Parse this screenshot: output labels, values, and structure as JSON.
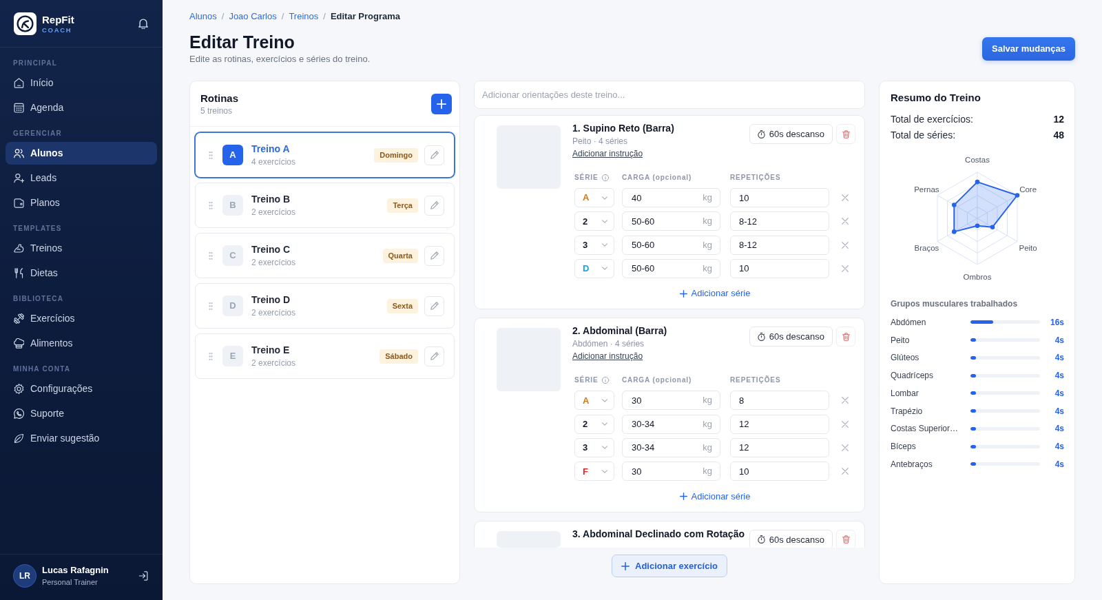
{
  "sidebar": {
    "brand": {
      "name": "RepFit",
      "tagline": "COACH"
    },
    "sections": [
      {
        "title": "PRINCIPAL",
        "items": [
          {
            "label": "Início",
            "selected": false
          },
          {
            "label": "Agenda",
            "selected": false
          }
        ]
      },
      {
        "title": "GERENCIAR",
        "items": [
          {
            "label": "Alunos",
            "selected": true
          },
          {
            "label": "Leads",
            "selected": false
          },
          {
            "label": "Planos",
            "selected": false
          }
        ]
      },
      {
        "title": "TEMPLATES",
        "items": [
          {
            "label": "Treinos",
            "selected": false
          },
          {
            "label": "Dietas",
            "selected": false
          }
        ]
      },
      {
        "title": "BIBLIOTECA",
        "items": [
          {
            "label": "Exercícios",
            "selected": false
          },
          {
            "label": "Alimentos",
            "selected": false
          }
        ]
      },
      {
        "title": "MINHA CONTA",
        "items": [
          {
            "label": "Configurações",
            "selected": false
          },
          {
            "label": "Suporte",
            "selected": false
          },
          {
            "label": "Enviar sugestão",
            "selected": false
          }
        ]
      }
    ],
    "user": {
      "initials": "LR",
      "name": "Lucas Rafagnin",
      "role": "Personal Trainer"
    }
  },
  "breadcrumb": [
    {
      "kind": "link",
      "label": "Alunos"
    },
    {
      "kind": "separator",
      "label": "/"
    },
    {
      "kind": "link",
      "label": "Joao Carlos"
    },
    {
      "kind": "separator",
      "label": "/"
    },
    {
      "kind": "link",
      "label": "Treinos"
    },
    {
      "kind": "separator",
      "label": "/"
    },
    {
      "kind": "current",
      "label": "Editar Programa"
    }
  ],
  "header": {
    "title": "Editar Treino",
    "subtitle": "Edite as rotinas, exercícios e séries do treino.",
    "save_button": "Salvar mudanças"
  },
  "routines": {
    "title": "Rotinas",
    "count": "5 treinos",
    "items": [
      {
        "letter": "A",
        "name": "Treino A",
        "exercises": "4 exercícios",
        "day": "Domingo",
        "selected": true
      },
      {
        "letter": "B",
        "name": "Treino B",
        "exercises": "2 exercícios",
        "day": "Terça",
        "selected": false
      },
      {
        "letter": "C",
        "name": "Treino C",
        "exercises": "2 exercícios",
        "day": "Quarta",
        "selected": false
      },
      {
        "letter": "D",
        "name": "Treino D",
        "exercises": "2 exercícios",
        "day": "Sexta",
        "selected": false
      },
      {
        "letter": "E",
        "name": "Treino E",
        "exercises": "2 exercícios",
        "day": "Sábado",
        "selected": false
      }
    ]
  },
  "workout": {
    "notes": {
      "placeholder": "Adicionar orientações deste treino..."
    },
    "exercises": [
      {
        "title": "1. Supino Reto (Barra)",
        "subtitle": "Peito · 4 séries",
        "instruction_link": "Adicionar instrução",
        "rest": "60s descanso",
        "columns": [
          "SÉRIE",
          "CARGA (opcional)",
          "REPETIÇÕES"
        ],
        "sets": [
          {
            "type": "A",
            "kind": "warmup",
            "load": "40",
            "unit": "kg",
            "reps": "10"
          },
          {
            "type": "2",
            "kind": "normal",
            "load": "50-60",
            "unit": "kg",
            "reps": "8-12"
          },
          {
            "type": "3",
            "kind": "normal",
            "load": "50-60",
            "unit": "kg",
            "reps": "8-12"
          },
          {
            "type": "D",
            "kind": "drop",
            "load": "50-60",
            "unit": "kg",
            "reps": "10"
          }
        ],
        "add_set": "Adicionar série"
      },
      {
        "title": "2. Abdominal (Barra)",
        "subtitle": "Abdómen · 4 séries",
        "instruction_link": "Adicionar instrução",
        "rest": "60s descanso",
        "columns": [
          "SÉRIE",
          "CARGA (opcional)",
          "REPETIÇÕES"
        ],
        "sets": [
          {
            "type": "A",
            "kind": "warmup",
            "load": "30",
            "unit": "kg",
            "reps": "8"
          },
          {
            "type": "2",
            "kind": "normal",
            "load": "30-34",
            "unit": "kg",
            "reps": "12"
          },
          {
            "type": "3",
            "kind": "normal",
            "load": "30-34",
            "unit": "kg",
            "reps": "12"
          },
          {
            "type": "F",
            "kind": "failure",
            "load": "30",
            "unit": "kg",
            "reps": "10"
          }
        ],
        "add_set": "Adicionar série"
      },
      {
        "title": "3. Abdominal Declinado com Rotação",
        "rest": "60s descanso"
      }
    ],
    "add_exercise": "Adicionar exercício"
  },
  "summary": {
    "title": "Resumo do Treino",
    "stats": [
      {
        "label": "Total de exercícios:",
        "value": "12"
      },
      {
        "label": "Total de séries:",
        "value": "48"
      }
    ],
    "radar": {
      "axes": [
        "Costas",
        "Core",
        "Peito",
        "Ombros",
        "Braços",
        "Pernas"
      ]
    },
    "muscles_title": "Grupos musculares trabalhados",
    "muscles": [
      {
        "name": "Abdómen",
        "level": 0.33,
        "value": "16s"
      },
      {
        "name": "Peito",
        "level": 0.083,
        "value": "4s"
      },
      {
        "name": "Glúteos",
        "level": 0.083,
        "value": "4s"
      },
      {
        "name": "Quadríceps",
        "level": 0.083,
        "value": "4s"
      },
      {
        "name": "Lombar",
        "level": 0.083,
        "value": "4s"
      },
      {
        "name": "Trapézio",
        "level": 0.083,
        "value": "4s"
      },
      {
        "name": "Costas Superior…",
        "level": 0.083,
        "value": "4s"
      },
      {
        "name": "Bíceps",
        "level": 0.083,
        "value": "4s"
      },
      {
        "name": "Antebraços",
        "level": 0.083,
        "value": "4s"
      }
    ]
  }
}
